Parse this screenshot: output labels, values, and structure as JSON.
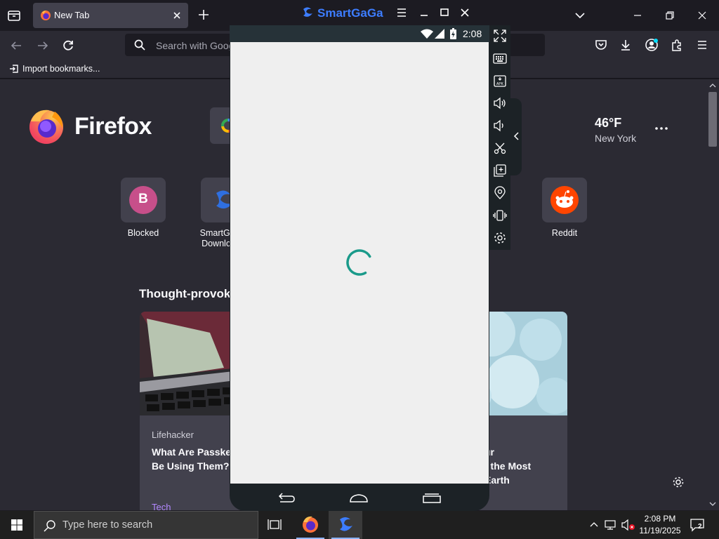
{
  "browser": {
    "tab_title": "New Tab",
    "url_placeholder": "Search with Google or enter address",
    "bookmark_import": "Import bookmarks..."
  },
  "newtab": {
    "brand": "Firefox",
    "weather": {
      "temp": "46°F",
      "city": "New York"
    },
    "top_sites": [
      {
        "label": "Blocked",
        "letter": "B",
        "color": "#c74f8a"
      },
      {
        "label": "SmartGaGa Downloads",
        "label_line1": "SmartGaGa",
        "label_line2": "Downloads"
      },
      {
        "label": "Reddit",
        "color": "#ff4500"
      }
    ],
    "stories_heading": "Thought-provoking stories",
    "stories": [
      {
        "source": "Lifehacker",
        "title_line1": "What Are Passkeys",
        "title_line2": "Be Using Them?",
        "tag": "Tech"
      },
      {
        "title_line1": "ur",
        "title_line2": "f the Most",
        "title_line3": "Earth"
      }
    ]
  },
  "emulator": {
    "name": "SmartGaGa",
    "status_time": "2:08",
    "loading": true,
    "side_tools": [
      "fullscreen-icon",
      "keyboard-icon",
      "apk-install-icon",
      "volume-up-icon",
      "volume-down-icon",
      "screenshot-icon",
      "multi-instance-icon",
      "location-icon",
      "shake-icon",
      "settings-icon"
    ]
  },
  "taskbar": {
    "search_placeholder": "Type here to search",
    "clock_time": "2:08 PM",
    "clock_date": "11/19/2025",
    "notification_count": "2"
  },
  "colors": {
    "firefox_dark": "#1c1b22",
    "firefox_toolbar": "#2b2a33",
    "tile_bg": "#42414d",
    "smartgaga_blue": "#3d7dff",
    "spinner_teal": "#1a9a8a"
  }
}
